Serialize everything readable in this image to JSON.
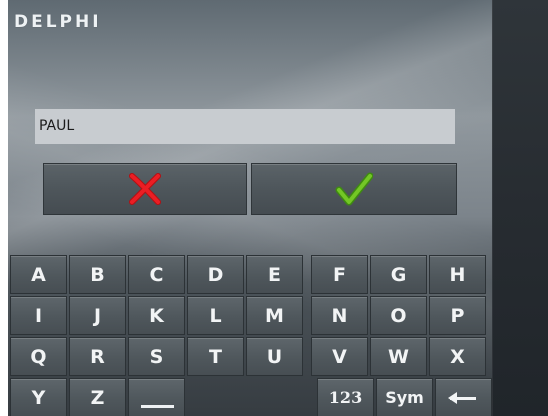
{
  "brand": {
    "logo_text": "DELPHI"
  },
  "name_field": {
    "value": "PAUL"
  },
  "actions": {
    "cancel_icon": "red-x-icon",
    "confirm_icon": "green-check-icon",
    "cancel_color": "#e0141a",
    "confirm_color": "#6cbf1e"
  },
  "keyboard": {
    "rows": [
      [
        "A",
        "B",
        "C",
        "D",
        "E",
        "F",
        "G",
        "H"
      ],
      [
        "I",
        "J",
        "K",
        "L",
        "M",
        "N",
        "O",
        "P"
      ],
      [
        "Q",
        "R",
        "S",
        "T",
        "U",
        "V",
        "W",
        "X"
      ]
    ],
    "bottom_row": {
      "y": "Y",
      "z": "Z",
      "space_icon": "space-icon",
      "numbers": "123",
      "symbols": "Sym",
      "backspace_icon": "backspace-arrow-icon"
    }
  }
}
